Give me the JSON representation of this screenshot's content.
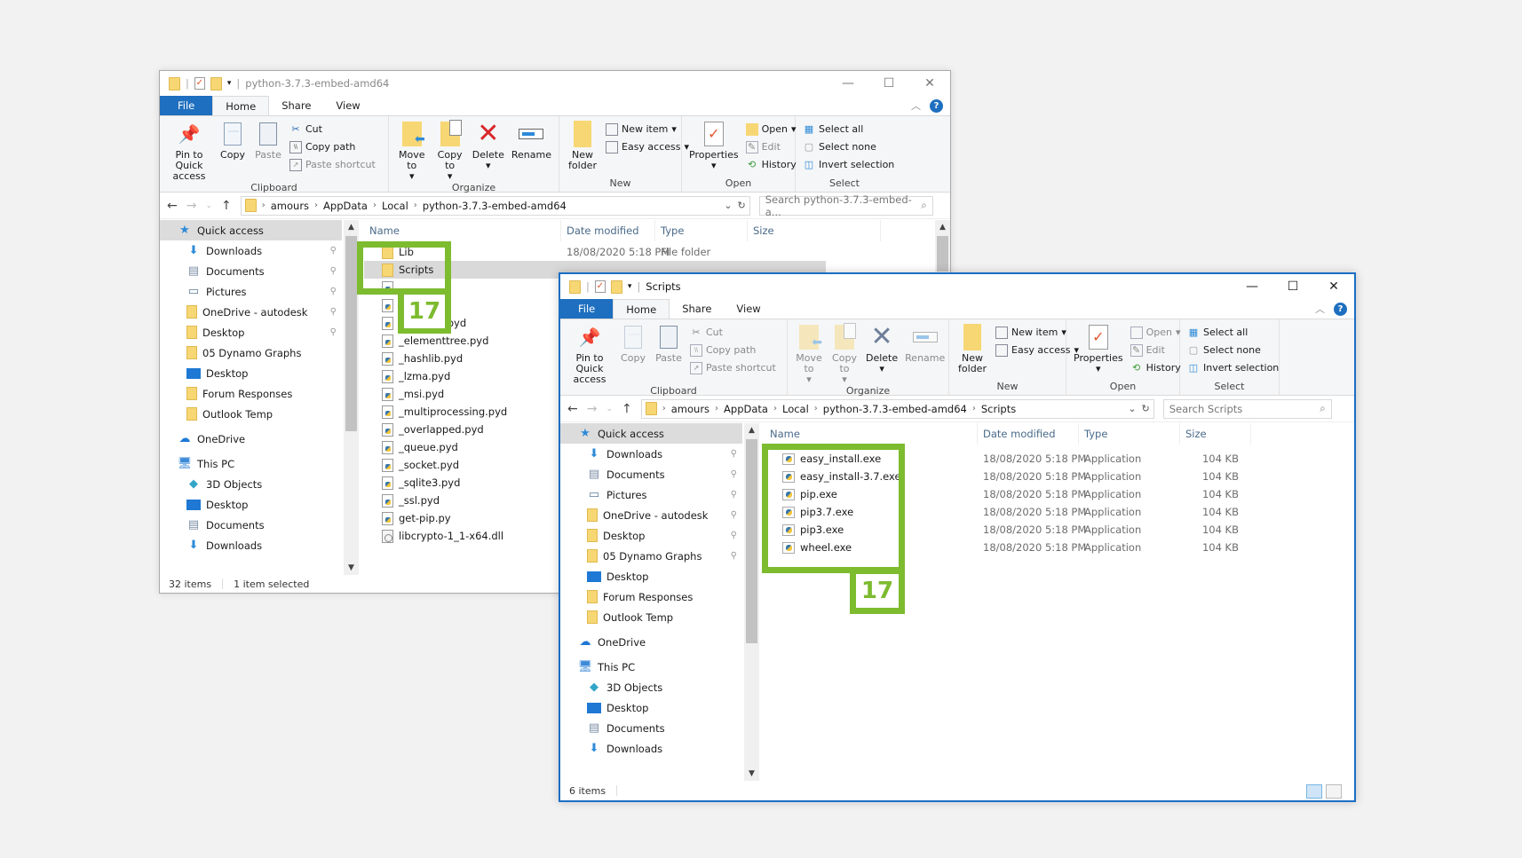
{
  "left_window": {
    "title": "python-3.7.3-embed-amd64",
    "tabs": [
      "File",
      "Home",
      "Share",
      "View"
    ],
    "ribbon": {
      "clipboard": {
        "label": "Clipboard",
        "pin": "Pin to Quick access",
        "copy": "Copy",
        "paste": "Paste",
        "cut": "Cut",
        "copy_path": "Copy path",
        "paste_shortcut": "Paste shortcut"
      },
      "organize": {
        "label": "Organize",
        "move_to": "Move to",
        "copy_to": "Copy to",
        "delete": "Delete",
        "rename": "Rename"
      },
      "new": {
        "label": "New",
        "new_folder": "New folder",
        "new_item": "New item",
        "easy_access": "Easy access"
      },
      "open": {
        "label": "Open",
        "properties": "Properties",
        "open": "Open",
        "edit": "Edit",
        "history": "History"
      },
      "select": {
        "label": "Select",
        "select_all": "Select all",
        "select_none": "Select none",
        "invert": "Invert selection"
      }
    },
    "breadcrumb": [
      "amours",
      "AppData",
      "Local",
      "python-3.7.3-embed-amd64"
    ],
    "search_placeholder": "Search python-3.7.3-embed-a...",
    "nav": [
      {
        "label": "Quick access",
        "icon": "star-icon",
        "pinned": false,
        "selected": true,
        "indent": 0
      },
      {
        "label": "Downloads",
        "icon": "download-icon",
        "pinned": true,
        "indent": 1
      },
      {
        "label": "Documents",
        "icon": "documents-icon",
        "pinned": true,
        "indent": 1
      },
      {
        "label": "Pictures",
        "icon": "pictures-icon",
        "pinned": true,
        "indent": 1
      },
      {
        "label": "OneDrive - autodesk",
        "icon": "folder-icon",
        "pinned": true,
        "indent": 1
      },
      {
        "label": "Desktop",
        "icon": "folder-icon",
        "pinned": true,
        "indent": 1
      },
      {
        "label": "05 Dynamo Graphs",
        "icon": "folder-icon",
        "pinned": false,
        "indent": 1
      },
      {
        "label": "Desktop",
        "icon": "desktop-icon",
        "pinned": false,
        "indent": 1
      },
      {
        "label": "Forum Responses",
        "icon": "folder-icon",
        "pinned": false,
        "indent": 1
      },
      {
        "label": "Outlook Temp",
        "icon": "folder-icon",
        "pinned": false,
        "indent": 1
      },
      {
        "label": "OneDrive",
        "icon": "cloud-icon",
        "pinned": false,
        "indent": 0,
        "gap": true
      },
      {
        "label": "This PC",
        "icon": "pc-icon",
        "pinned": false,
        "indent": 0,
        "gap": true
      },
      {
        "label": "3D Objects",
        "icon": "3d-objects-icon",
        "pinned": false,
        "indent": 1
      },
      {
        "label": "Desktop",
        "icon": "desktop-icon",
        "pinned": false,
        "indent": 1
      },
      {
        "label": "Documents",
        "icon": "documents-icon",
        "pinned": false,
        "indent": 1
      },
      {
        "label": "Downloads",
        "icon": "download-icon",
        "pinned": false,
        "indent": 1
      }
    ],
    "columns": [
      "Name",
      "Date modified",
      "Type",
      "Size"
    ],
    "files": [
      {
        "name": "Lib",
        "kind": "folder",
        "date": "18/08/2020 5:18 PM",
        "type": "File folder",
        "size": ""
      },
      {
        "name": "Scripts",
        "kind": "folder",
        "date": "",
        "type": "",
        "size": "",
        "selected": true
      },
      {
        "name": "_",
        "kind": "py",
        "date": "",
        "type": "",
        "size": ""
      },
      {
        "name": "_",
        "kind": "py",
        "date": "",
        "type": "",
        "size": ""
      },
      {
        "name": "_decimal.pyd",
        "kind": "py",
        "date": "",
        "type": "",
        "size": ""
      },
      {
        "name": "_elementtree.pyd",
        "kind": "py",
        "date": "",
        "type": "",
        "size": ""
      },
      {
        "name": "_hashlib.pyd",
        "kind": "py",
        "date": "",
        "type": "",
        "size": ""
      },
      {
        "name": "_lzma.pyd",
        "kind": "py",
        "date": "",
        "type": "",
        "size": ""
      },
      {
        "name": "_msi.pyd",
        "kind": "py",
        "date": "",
        "type": "",
        "size": ""
      },
      {
        "name": "_multiprocessing.pyd",
        "kind": "py",
        "date": "",
        "type": "",
        "size": ""
      },
      {
        "name": "_overlapped.pyd",
        "kind": "py",
        "date": "",
        "type": "",
        "size": ""
      },
      {
        "name": "_queue.pyd",
        "kind": "py",
        "date": "",
        "type": "",
        "size": ""
      },
      {
        "name": "_socket.pyd",
        "kind": "py",
        "date": "",
        "type": "",
        "size": ""
      },
      {
        "name": "_sqlite3.pyd",
        "kind": "py",
        "date": "",
        "type": "",
        "size": ""
      },
      {
        "name": "_ssl.pyd",
        "kind": "py",
        "date": "",
        "type": "",
        "size": ""
      },
      {
        "name": "get-pip.py",
        "kind": "py",
        "date": "",
        "type": "",
        "size": ""
      },
      {
        "name": "libcrypto-1_1-x64.dll",
        "kind": "dll",
        "date": "",
        "type": "",
        "size": ""
      }
    ],
    "status": {
      "items": "32 items",
      "selected": "1 item selected"
    }
  },
  "right_window": {
    "title": "Scripts",
    "tabs": [
      "File",
      "Home",
      "Share",
      "View"
    ],
    "ribbon": {
      "clipboard": {
        "label": "Clipboard",
        "pin": "Pin to Quick access",
        "copy": "Copy",
        "paste": "Paste",
        "cut": "Cut",
        "copy_path": "Copy path",
        "paste_shortcut": "Paste shortcut"
      },
      "organize": {
        "label": "Organize",
        "move_to": "Move to",
        "copy_to": "Copy to",
        "delete": "Delete",
        "rename": "Rename"
      },
      "new": {
        "label": "New",
        "new_folder": "New folder",
        "new_item": "New item",
        "easy_access": "Easy access"
      },
      "open": {
        "label": "Open",
        "properties": "Properties",
        "open": "Open",
        "edit": "Edit",
        "history": "History"
      },
      "select": {
        "label": "Select",
        "select_all": "Select all",
        "select_none": "Select none",
        "invert": "Invert selection"
      }
    },
    "breadcrumb": [
      "amours",
      "AppData",
      "Local",
      "python-3.7.3-embed-amd64",
      "Scripts"
    ],
    "search_placeholder": "Search Scripts",
    "nav": [
      {
        "label": "Quick access",
        "icon": "star-icon",
        "pinned": false,
        "selected": true,
        "indent": 0
      },
      {
        "label": "Downloads",
        "icon": "download-icon",
        "pinned": true,
        "indent": 1
      },
      {
        "label": "Documents",
        "icon": "documents-icon",
        "pinned": true,
        "indent": 1
      },
      {
        "label": "Pictures",
        "icon": "pictures-icon",
        "pinned": true,
        "indent": 1
      },
      {
        "label": "OneDrive - autodesk",
        "icon": "folder-icon",
        "pinned": true,
        "indent": 1
      },
      {
        "label": "Desktop",
        "icon": "folder-icon",
        "pinned": true,
        "indent": 1
      },
      {
        "label": "05 Dynamo Graphs",
        "icon": "folder-icon",
        "pinned": true,
        "indent": 1
      },
      {
        "label": "Desktop",
        "icon": "desktop-icon",
        "pinned": false,
        "indent": 1
      },
      {
        "label": "Forum Responses",
        "icon": "folder-icon",
        "pinned": false,
        "indent": 1
      },
      {
        "label": "Outlook Temp",
        "icon": "folder-icon",
        "pinned": false,
        "indent": 1
      },
      {
        "label": "OneDrive",
        "icon": "cloud-icon",
        "pinned": false,
        "indent": 0,
        "gap": true
      },
      {
        "label": "This PC",
        "icon": "pc-icon",
        "pinned": false,
        "indent": 0,
        "gap": true
      },
      {
        "label": "3D Objects",
        "icon": "3d-objects-icon",
        "pinned": false,
        "indent": 1
      },
      {
        "label": "Desktop",
        "icon": "desktop-icon",
        "pinned": false,
        "indent": 1
      },
      {
        "label": "Documents",
        "icon": "documents-icon",
        "pinned": false,
        "indent": 1
      },
      {
        "label": "Downloads",
        "icon": "download-icon",
        "pinned": false,
        "indent": 1
      }
    ],
    "columns": [
      "Name",
      "Date modified",
      "Type",
      "Size"
    ],
    "files": [
      {
        "name": "easy_install.exe",
        "kind": "exe",
        "date": "18/08/2020 5:18 PM",
        "type": "Application",
        "size": "104 KB"
      },
      {
        "name": "easy_install-3.7.exe",
        "kind": "exe",
        "date": "18/08/2020 5:18 PM",
        "type": "Application",
        "size": "104 KB"
      },
      {
        "name": "pip.exe",
        "kind": "exe",
        "date": "18/08/2020 5:18 PM",
        "type": "Application",
        "size": "104 KB"
      },
      {
        "name": "pip3.7.exe",
        "kind": "exe",
        "date": "18/08/2020 5:18 PM",
        "type": "Application",
        "size": "104 KB"
      },
      {
        "name": "pip3.exe",
        "kind": "exe",
        "date": "18/08/2020 5:18 PM",
        "type": "Application",
        "size": "104 KB"
      },
      {
        "name": "wheel.exe",
        "kind": "exe",
        "date": "18/08/2020 5:18 PM",
        "type": "Application",
        "size": "104 KB"
      }
    ],
    "status": {
      "items": "6 items"
    }
  },
  "annotations": {
    "step_badge_left": "17",
    "step_badge_right": "17",
    "highlight_color": "#7dbb2f"
  },
  "colors": {
    "file_tab": "#1e6fbf",
    "active_window_border": "#1a6ec4"
  }
}
